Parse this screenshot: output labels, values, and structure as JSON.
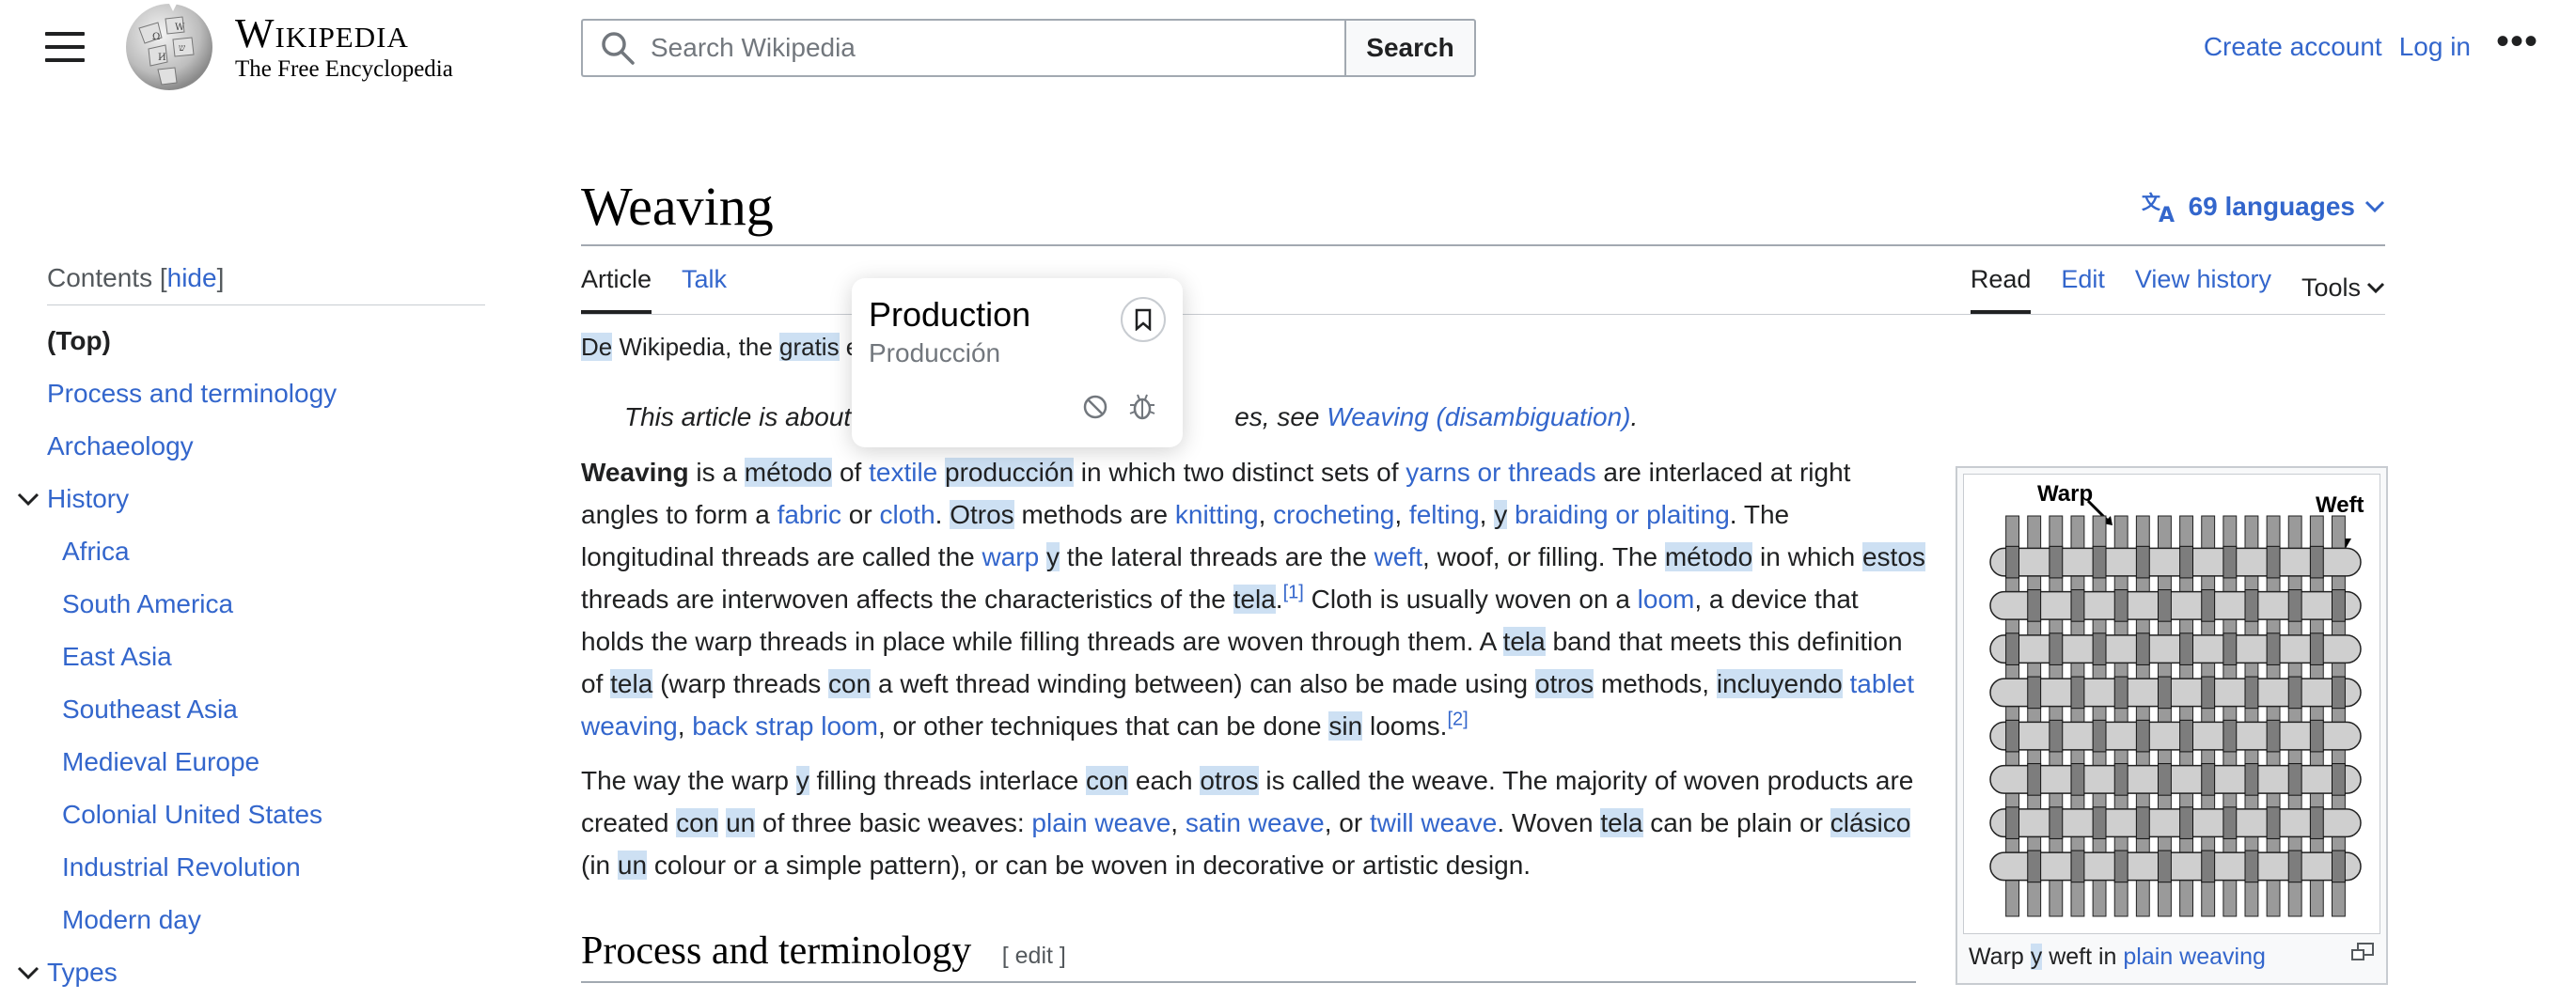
{
  "header": {
    "wordmark_title": "Wikipedia",
    "wordmark_tagline": "The Free Encyclopedia",
    "search_placeholder": "Search Wikipedia",
    "search_button": "Search",
    "create_account": "Create account",
    "log_in": "Log in",
    "more": "•••"
  },
  "toc": {
    "label": "Contents",
    "hide_open": "[",
    "hide": "hide",
    "hide_close": "]",
    "items": [
      {
        "label": "(Top)"
      },
      {
        "label": "Process and terminology"
      },
      {
        "label": "Archaeology"
      },
      {
        "label": "History"
      },
      {
        "label": "Africa"
      },
      {
        "label": "South America"
      },
      {
        "label": "East Asia"
      },
      {
        "label": "Southeast Asia"
      },
      {
        "label": "Medieval Europe"
      },
      {
        "label": "Colonial United States"
      },
      {
        "label": "Industrial Revolution"
      },
      {
        "label": "Modern day"
      },
      {
        "label": "Types"
      }
    ]
  },
  "article": {
    "title": "Weaving",
    "languages": "69 languages",
    "tabs_left": [
      "Article",
      "Talk"
    ],
    "tabs_right": [
      "Read",
      "Edit",
      "View history",
      "Tools"
    ],
    "tagline": {
      "w1": "De",
      "w2": " Wikipedia, the ",
      "w3": "gratis",
      "w4": " e"
    },
    "hatnote": {
      "t1": "This article is about",
      "t2": "es, see ",
      "link": "Weaving (disambiguation)",
      "t3": "."
    },
    "p1": {
      "s1": "Weaving",
      "s2": " is a ",
      "s3": "método",
      "s4": " of ",
      "s5": "textile",
      "s6": " ",
      "s7": "producción",
      "s8": " in which two distinct sets of ",
      "s9": "yarns or threads",
      "s10": " are interlaced at right angles to form a ",
      "s11": "fabric",
      "s12": " or ",
      "s13": "cloth",
      "s14": ". ",
      "s15": "Otros",
      "s16": " methods are ",
      "s17": "knitting",
      "s18": ", ",
      "s19": "crocheting",
      "s20": ", ",
      "s21": "felting",
      "s22": ", ",
      "s23": "y",
      "s24": " ",
      "s25": "braiding or plaiting",
      "s26": ". The longitudinal threads are called the ",
      "s27": "warp",
      "s28": " ",
      "s29": "y",
      "s30": " the lateral threads are the ",
      "s31": "weft",
      "s32": ", woof, or filling. The ",
      "s33": "método",
      "s34": " in which ",
      "s35": "estos",
      "s36": " threads are interwoven affects the characteristics of the ",
      "s37": "tela",
      "s38": ".",
      "s39": "[1]",
      "s40": " Cloth is usually woven on a ",
      "s41": "loom",
      "s42": ", a device that holds the warp threads in place while filling threads are woven through them. A ",
      "s43": "tela",
      "s44": " band that meets this definition of ",
      "s45": "tela",
      "s46": " (warp threads ",
      "s47": "con",
      "s48": " a weft thread winding between) can also be made using ",
      "s49": "otros",
      "s50": " methods, ",
      "s51": "incluyendo",
      "s52": " ",
      "s53": "tablet weaving",
      "s54": ", ",
      "s55": "back strap loom",
      "s56": ", or other techniques that can be done ",
      "s57": "sin",
      "s58": " looms.",
      "s59": "[2]"
    },
    "p2": {
      "s1": "The way the warp ",
      "s2": "y",
      "s3": " filling threads interlace ",
      "s4": "con",
      "s5": " each ",
      "s6": "otros",
      "s7": " is called the weave. The majority of woven products are created ",
      "s8": "con",
      "s9": " ",
      "s10": "un",
      "s11": " of three basic weaves: ",
      "s12": "plain weave",
      "s13": ", ",
      "s14": "satin weave",
      "s15": ", or ",
      "s16": "twill weave",
      "s17": ". Woven ",
      "s18": "tela",
      "s19": " can be plain or ",
      "s20": "clásico",
      "s21": " (in ",
      "s22": "un",
      "s23": " colour or a simple pattern), or can be woven in decorative or artistic design."
    },
    "section_heading": "Process and terminology",
    "section_edit": "[ edit ]"
  },
  "infobox": {
    "warp_label": "Warp",
    "weft_label": "Weft",
    "caption_1": "Warp ",
    "caption_y": "y",
    "caption_2": " weft in ",
    "caption_link": "plain weaving"
  },
  "popup": {
    "title": "Production",
    "subtitle": "Producción"
  },
  "colors": {
    "link": "#3366cc",
    "highlight": "#cde0f3",
    "text": "#202122"
  }
}
